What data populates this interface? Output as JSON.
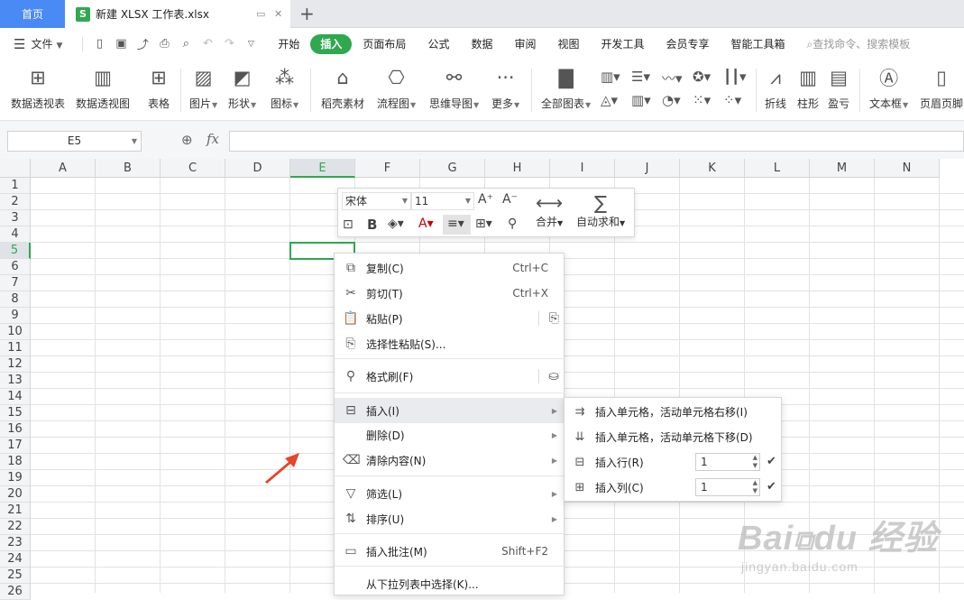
{
  "tabs": {
    "home": "首页",
    "file_name": "新建 XLSX 工作表.xlsx",
    "file_icon": "S"
  },
  "menubar": {
    "file": "文件",
    "menus": [
      "开始",
      "插入",
      "页面布局",
      "公式",
      "数据",
      "审阅",
      "视图",
      "开发工具",
      "会员专享",
      "智能工具箱"
    ],
    "active_menu": "插入",
    "search": "查找命令、搜索模板"
  },
  "ribbon": {
    "pivot_table": "数据透视表",
    "pivot_chart": "数据透视图",
    "table": "表格",
    "picture": "图片",
    "shape": "形状",
    "icon": "图标",
    "material": "稻壳素材",
    "flowchart": "流程图",
    "mindmap": "思维导图",
    "more": "更多",
    "all_charts": "全部图表",
    "line": "折线",
    "column": "柱形",
    "winloss": "盈亏",
    "textbox": "文本框",
    "header_footer": "页眉页脚"
  },
  "formula_bar": {
    "name_box": "E5",
    "fx": "fx",
    "value": ""
  },
  "grid": {
    "columns": [
      "A",
      "B",
      "C",
      "D",
      "E",
      "F",
      "G",
      "H",
      "I",
      "J",
      "K",
      "L",
      "M",
      "N"
    ],
    "rows": [
      "1",
      "2",
      "3",
      "4",
      "5",
      "6",
      "7",
      "8",
      "9",
      "10",
      "11",
      "12",
      "13",
      "14",
      "15",
      "16",
      "17",
      "18",
      "19",
      "20",
      "21",
      "22",
      "23",
      "24",
      "25",
      "26"
    ],
    "selected_col": "E",
    "selected_row": "5"
  },
  "mini_toolbar": {
    "font": "宋体",
    "size": "11",
    "bold": "B",
    "merge": "合并",
    "autosum": "自动求和"
  },
  "context_menu": {
    "items": [
      {
        "label": "复制(C)",
        "shortcut": "Ctrl+C"
      },
      {
        "label": "剪切(T)",
        "shortcut": "Ctrl+X"
      },
      {
        "label": "粘贴(P)"
      },
      {
        "label": "选择性粘贴(S)..."
      },
      {
        "label": "格式刷(F)"
      },
      {
        "label": "插入(I)"
      },
      {
        "label": "删除(D)"
      },
      {
        "label": "清除内容(N)"
      },
      {
        "label": "筛选(L)"
      },
      {
        "label": "排序(U)"
      },
      {
        "label": "插入批注(M)",
        "shortcut": "Shift+F2"
      },
      {
        "label": "从下拉列表中选择(K)..."
      }
    ]
  },
  "insert_submenu": {
    "items": [
      {
        "label": "插入单元格，活动单元格右移(I)"
      },
      {
        "label": "插入单元格，活动单元格下移(D)"
      },
      {
        "label": "插入行(R)",
        "value": "1"
      },
      {
        "label": "插入列(C)",
        "value": "1"
      }
    ]
  },
  "watermark": {
    "brand": "Bai du 经验",
    "url": "jingyan.baidu.com"
  },
  "colors": {
    "accent": "#2fa84f",
    "home_tab": "#4a8af4",
    "arrow": "#e8442a"
  }
}
